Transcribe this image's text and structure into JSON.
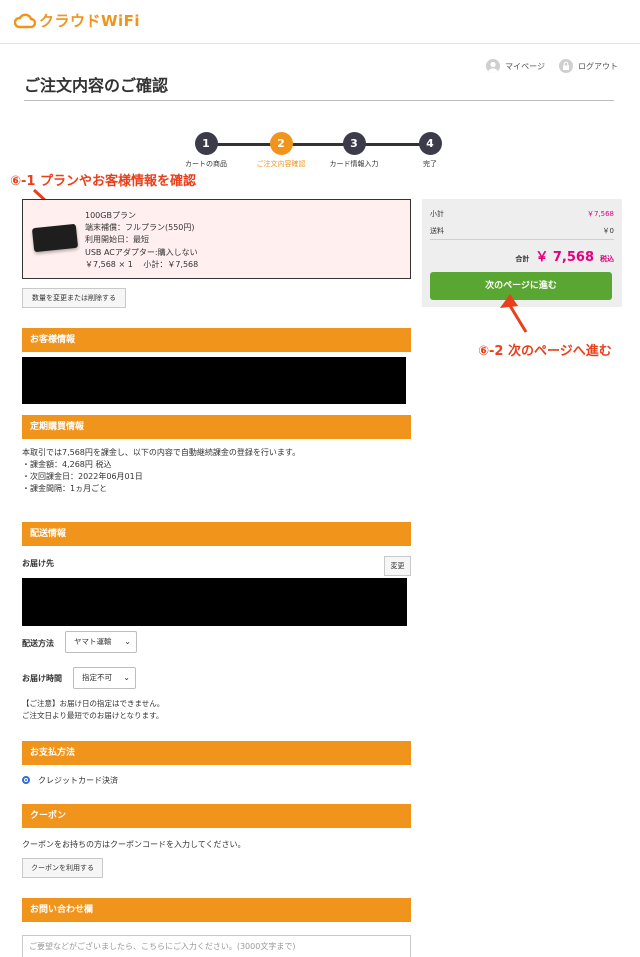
{
  "header": {
    "logo_text": "クラウドWiFi",
    "links": [
      {
        "label": "マイページ",
        "icon": "user-icon"
      },
      {
        "label": "ログアウト",
        "icon": "lock-icon"
      }
    ]
  },
  "page": {
    "title": "ご注文内容のご確認"
  },
  "steps": [
    {
      "num": "1",
      "label": "カートの商品",
      "active": false
    },
    {
      "num": "2",
      "label": "ご注文内容確認",
      "active": true
    },
    {
      "num": "3",
      "label": "カード情報入力",
      "active": false
    },
    {
      "num": "4",
      "label": "完了",
      "active": false
    }
  ],
  "annotations": {
    "a1": "⑥-1 プランやお客様情報を確認",
    "a2": "⑥-2 次のページへ進む",
    "color": "#e8401c"
  },
  "cart": {
    "lines": [
      "100GBプラン",
      "端末補償：フルプラン(550円)",
      "利用開始日：最短",
      "USB ACアダプター:購入しない",
      "￥7,568 × 1　 小計：￥7,568"
    ],
    "edit_button": "数量を変更または削除する"
  },
  "summary": {
    "subtotal_label": "小計",
    "subtotal_value": "￥7,568",
    "shipping_label": "送料",
    "shipping_value": "￥0",
    "total_label": "合計",
    "total_value": "￥ 7,568",
    "tax_label": "税込",
    "next_button": "次のページに進む"
  },
  "customer": {
    "title": "お客様情報"
  },
  "subscription": {
    "title": "定期購買情報",
    "lines": [
      "本取引では7,568円を課金し、以下の内容で自動継続課金の登録を行います。",
      "・課金額：4,268円 税込",
      "・次回課金日：2022年06月01日",
      "・課金間隔：1ヵ月ごと"
    ]
  },
  "shipping": {
    "title": "配送情報",
    "destination_label": "お届け先",
    "change_button": "変更",
    "method_label": "配送方法",
    "method_value": "ヤマト運輸",
    "time_label": "お届け時間",
    "time_value": "指定不可",
    "notes": [
      "【ご注意】お届け日の指定はできません。",
      "ご注文日より最短でのお届けとなります。"
    ]
  },
  "payment": {
    "title": "お支払方法",
    "option": "クレジットカード決済"
  },
  "coupon": {
    "title": "クーポン",
    "text": "クーポンをお持ちの方はクーポンコードを入力してください。",
    "button": "クーポンを利用する"
  },
  "inquiry": {
    "title": "お問い合わせ欄",
    "placeholder": "ご要望などがございましたら、こちらにご入力ください。(3000文字まで)"
  },
  "colors": {
    "accent": "#f0941c",
    "price": "#e4007f",
    "next": "#5aa632"
  }
}
